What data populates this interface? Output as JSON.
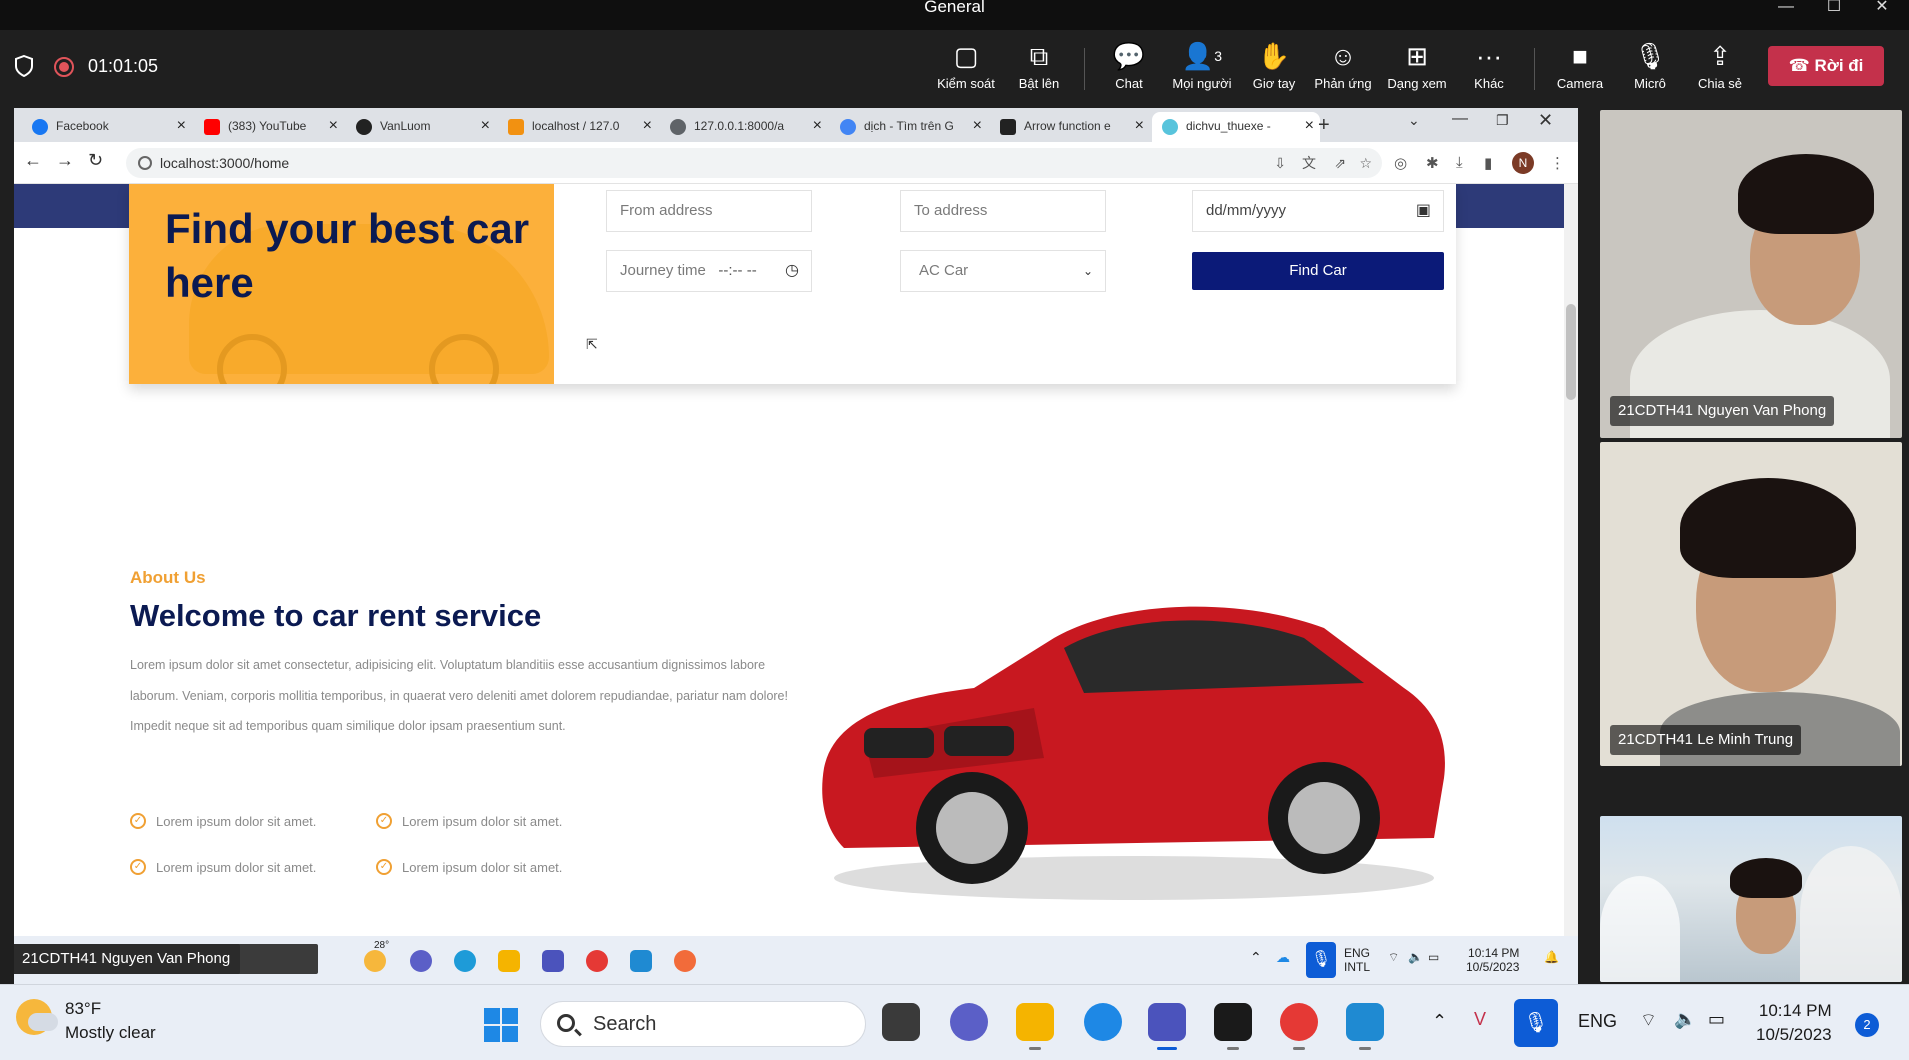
{
  "window": {
    "title": "General",
    "controls": [
      "—",
      "☐",
      "✕"
    ]
  },
  "meeting": {
    "timer": "01:01:05",
    "toolbar": [
      {
        "label": "Kiểm soát",
        "icon": "screen-control-icon"
      },
      {
        "label": "Bật lên",
        "icon": "pop-out-icon"
      },
      {
        "label": "Chat",
        "icon": "chat-icon"
      },
      {
        "label": "Mọi người",
        "icon": "people-icon",
        "badge": "3"
      },
      {
        "label": "Giơ tay",
        "icon": "raise-hand-icon"
      },
      {
        "label": "Phản ứng",
        "icon": "reaction-icon"
      },
      {
        "label": "Dạng xem",
        "icon": "view-icon"
      },
      {
        "label": "Khác",
        "icon": "more-icon"
      },
      {
        "label": "Camera",
        "icon": "camera-icon"
      },
      {
        "label": "Micrô",
        "icon": "mic-icon"
      },
      {
        "label": "Chia sẻ",
        "icon": "share-icon"
      }
    ],
    "leave_label": "Rời đi",
    "participants": [
      {
        "name": "21CDTH41 Nguyen Van Phong"
      },
      {
        "name": "21CDTH41 Le Minh Trung"
      },
      {
        "name": ""
      }
    ]
  },
  "browser": {
    "tabs": [
      {
        "title": "Facebook",
        "color": "#1877f2"
      },
      {
        "title": "(383) YouTube",
        "color": "#ff0000"
      },
      {
        "title": "VanLuom",
        "color": "#222222"
      },
      {
        "title": "localhost / 127.0",
        "color": "#f29111"
      },
      {
        "title": "127.0.0.1:8000/a",
        "color": "#5f6368"
      },
      {
        "title": "dịch - Tìm trên G",
        "color": "#4285f4"
      },
      {
        "title": "Arrow function e",
        "color": "#222222"
      },
      {
        "title": "dichvu_thuexe -",
        "color": "#58c4dc"
      }
    ],
    "url": "localhost:3000/home",
    "profile_initial": "N"
  },
  "page": {
    "hero_title": "Find your best car here",
    "from_placeholder": "From address",
    "to_placeholder": "To address",
    "date_placeholder": "dd/mm/yyyy",
    "journey_label": "Journey time",
    "journey_value": "--:-- --",
    "car_type": "AC Car",
    "find_button": "Find Car",
    "about_tag": "About Us",
    "about_title": "Welcome to car rent service",
    "about_body": "Lorem ipsum dolor sit amet consectetur, adipisicing elit. Voluptatum blanditiis esse accusantium dignissimos labore laborum. Veniam, corporis mollitia temporibus, in quaerat vero deleniti amet dolorem repudiandae, pariatur nam dolore! Impedit neque sit ad temporibus quam similique dolor ipsam praesentium sunt.",
    "checks": [
      "Lorem ipsum dolor sit amet.",
      "Lorem ipsum dolor sit amet.",
      "Lorem ipsum dolor sit amet.",
      "Lorem ipsum dolor sit amet."
    ],
    "colors": {
      "yellow": "#fcb03b",
      "navy": "#0b1a52",
      "button": "#0b1a78",
      "accent": "#f0a033"
    }
  },
  "inner_taskbar": {
    "presenter_label": "21CDTH41 Nguyen Van Phong",
    "weather_badge": "28°",
    "lang_top": "ENG",
    "lang_bottom": "INTL",
    "time": "10:14 PM",
    "date": "10/5/2023"
  },
  "taskbar": {
    "temperature": "83°F",
    "condition": "Mostly clear",
    "search_placeholder": "Search",
    "language": "ENG",
    "time": "10:14 PM",
    "date": "10/5/2023",
    "notifications": "2"
  }
}
